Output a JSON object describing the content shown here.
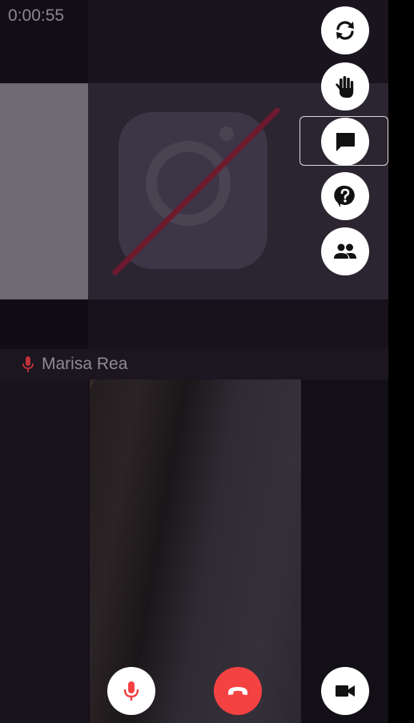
{
  "call": {
    "elapsed": "0:00:55",
    "participant_name": "Marisa Rea"
  },
  "icons": {
    "switch_camera": "switch-camera-icon",
    "raise_hand": "raise-hand-icon",
    "chat": "chat-icon",
    "help": "help-icon",
    "participants": "participants-icon",
    "microphone": "microphone-icon",
    "end_call": "end-call-icon",
    "video_camera": "video-camera-icon"
  },
  "colors": {
    "end_call": "#f44242",
    "mic_active": "#f44242",
    "button_bg": "#ffffff",
    "icon_dark": "#111111",
    "camera_off_slash": "#6d1a2e"
  }
}
